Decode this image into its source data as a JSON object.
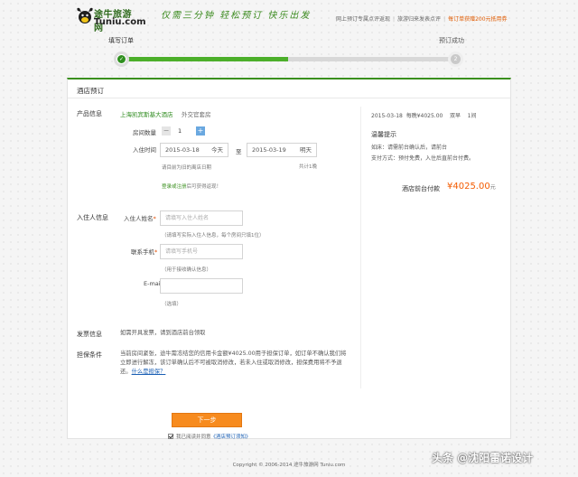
{
  "header": {
    "logo_cn": "途牛旅游网",
    "logo_en": "Tuniu.com",
    "slogan": "仅需三分钟  轻松预订  快乐出发",
    "links": [
      "网上预订专属点评返现",
      "旅游归来发表点评",
      "每订单获赠200元抵用券"
    ]
  },
  "progress": {
    "step1_label": "填写订单",
    "step2_label": "预订成功",
    "step1_mark": "✓",
    "step2_mark": "2",
    "accent": "#4caf2a"
  },
  "panel": {
    "title": "酒店预订"
  },
  "product": {
    "section_label": "产品信息",
    "hotel_name": "上海凯宾斯基大酒店",
    "room_type": "外交官套房",
    "rooms_label": "房间数量",
    "rooms_value": "1",
    "minus_icon": "−",
    "plus_icon": "+",
    "checkin_label": "入住时间",
    "checkin_date": "2015-03-18",
    "checkin_weekday": "今天",
    "to_label": "至",
    "checkout_date": "2015-03-19",
    "checkout_weekday": "明天",
    "nights": "共计1晚",
    "date_hint": "请目前为旧的离店日期",
    "reward_prefix": "登录",
    "reward_hl": "或注册",
    "reward_suffix": "后可获得返现！"
  },
  "guest": {
    "section_label": "入住人信息",
    "name_label": "入住人姓名",
    "name_placeholder": "请填写入住人姓名",
    "name_hint": "（请填写实际入住人信息，每个房间只填1位）",
    "phone_label": "联系手机",
    "phone_placeholder": "请填写手机号",
    "phone_hint": "（用于接收确认信息）",
    "email_label": "E-mail",
    "email_placeholder": "",
    "email_hint": "（选填）",
    "required_mark": "*"
  },
  "invoice": {
    "section_label": "发票信息",
    "text": "如需开具发票，请到酒店前台领取"
  },
  "guarantee": {
    "section_label": "担保条件",
    "text": "当前房间紧张，途牛需冻结您的信用卡金额¥4025.00用于担保订单，如订单不确认我们将立即进行解冻，该订单确认后不可被取消修改，若未入住或取消修改，担保费用将不予退还。",
    "link": "什么是担保？"
  },
  "summary": {
    "line_date": "2015-03-18",
    "line_price": "每晚¥4025.00",
    "line_room": "双早",
    "line_qty": "1间",
    "tips_title": "温馨提示",
    "tip1": "如床：请需前台确认后，请前台",
    "tip2": "支付方式：预付免费，入住后直前台付费。",
    "total_label": "酒店前台付款",
    "total_value": "¥4025.00",
    "total_unit": "元"
  },
  "actions": {
    "next_label": "下一步",
    "agree_text": "我已阅读并同意",
    "agree_link": "《酒店预订须知》"
  },
  "footer": {
    "copyright": "Copyright © 2006-2014  途牛旅游网  Tuniu.com"
  },
  "watermark": {
    "text": "头条 @沈阳雷诺设计"
  }
}
